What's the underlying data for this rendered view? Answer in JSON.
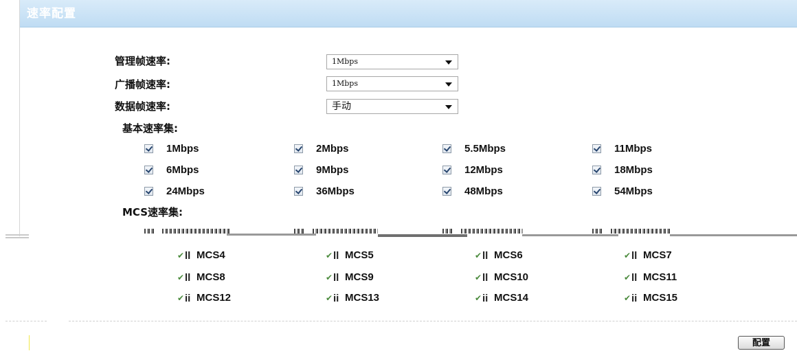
{
  "panel": {
    "title": "速率配置"
  },
  "form": {
    "mgmt_rate": {
      "label": "管理帧速率:",
      "value": "1Mbps"
    },
    "bcast_rate": {
      "label": "广播帧速率:",
      "value": "1Mbps"
    },
    "data_rate": {
      "label": "数据帧速率:",
      "value": "手动"
    }
  },
  "basic_rates": {
    "label": "基本速率集:",
    "items": [
      {
        "label": "1Mbps",
        "checked": true
      },
      {
        "label": "2Mbps",
        "checked": true
      },
      {
        "label": "5.5Mbps",
        "checked": true
      },
      {
        "label": "11Mbps",
        "checked": true
      },
      {
        "label": "6Mbps",
        "checked": true
      },
      {
        "label": "9Mbps",
        "checked": true
      },
      {
        "label": "12Mbps",
        "checked": true
      },
      {
        "label": "18Mbps",
        "checked": true
      },
      {
        "label": "24Mbps",
        "checked": true
      },
      {
        "label": "36Mbps",
        "checked": true
      },
      {
        "label": "48Mbps",
        "checked": true
      },
      {
        "label": "54Mbps",
        "checked": true
      }
    ]
  },
  "mcs_rates": {
    "label": "MCS速率集:",
    "items": [
      {
        "label": "MCS4",
        "bars": "ll",
        "checked": true
      },
      {
        "label": "MCS5",
        "bars": "ll",
        "checked": true
      },
      {
        "label": "MCS6",
        "bars": "ll",
        "checked": true
      },
      {
        "label": "MCS7",
        "bars": "ll",
        "checked": true
      },
      {
        "label": "MCS8",
        "bars": "ll",
        "checked": true
      },
      {
        "label": "MCS9",
        "bars": "ll",
        "checked": true
      },
      {
        "label": "MCS10",
        "bars": "ll",
        "checked": true
      },
      {
        "label": "MCS11",
        "bars": "ll",
        "checked": true
      },
      {
        "label": "MCS12",
        "bars": "ii",
        "checked": true
      },
      {
        "label": "MCS13",
        "bars": "ii",
        "checked": true
      },
      {
        "label": "MCS14",
        "bars": "ii",
        "checked": true
      },
      {
        "label": "MCS15",
        "bars": "ii",
        "checked": true
      }
    ]
  },
  "icons": {
    "checkbox": "checkmark-icon",
    "dropdown": "chevron-down-icon"
  },
  "actions": {
    "config_label": "配置"
  },
  "colors": {
    "header_bg": "#bfdcf3",
    "mcs_check": "#4a8a3c"
  }
}
